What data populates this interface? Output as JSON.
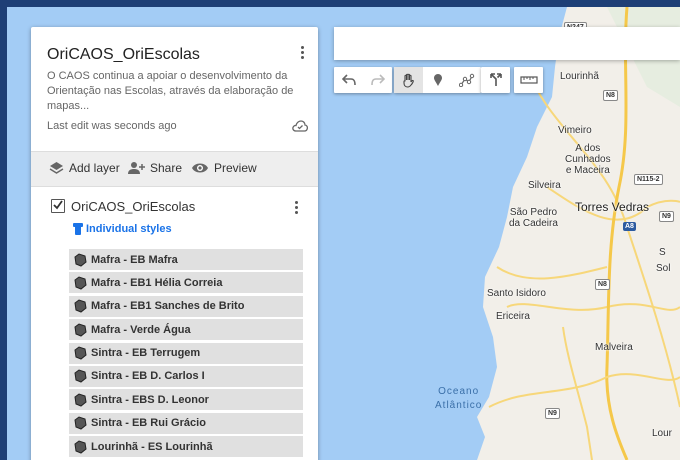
{
  "panel": {
    "title": "OriCAOS_OriEscolas",
    "description": "O CAOS continua a apoiar o desenvolvimento da Orientação nas Escolas, através da elaboração de mapas...",
    "last_edit": "Last edit was seconds ago",
    "actions": {
      "add_layer": "Add layer",
      "share": "Share",
      "preview": "Preview"
    },
    "layer": {
      "name": "OriCAOS_OriEscolas",
      "checked": true,
      "styles_label": "Individual styles",
      "features": [
        "Mafra - EB Mafra",
        "Mafra - EB1 Hélia Correia",
        "Mafra - EB1 Sanches de Brito",
        "Mafra - Verde Água",
        "Sintra - EB Terrugem",
        "Sintra - EB D. Carlos I",
        "Sintra - EBS D. Leonor",
        "Sintra - EB Rui Grácio",
        "Lourinhã - ES Lourinhã"
      ]
    }
  },
  "search": {
    "placeholder": ""
  },
  "toolbar": {
    "group1": [
      "undo-icon",
      "redo-icon"
    ],
    "group2": [
      "hand-icon",
      "marker-icon",
      "draw-line-icon"
    ],
    "group3": [
      "directions-icon"
    ],
    "group4": [
      "ruler-icon"
    ],
    "selected": "hand-icon"
  },
  "map": {
    "places": {
      "lourinha": "Lourinhã",
      "vimeiro": "Vimeiro",
      "a_dos_cunhados": "A dos\nCunhados\ne Maceira",
      "silveira": "Silveira",
      "sao_pedro": "São Pedro\nda Cadeira",
      "torres_vedras": "Torres Vedras",
      "santo_isidoro": "Santo Isidoro",
      "ericeira": "Ericeira",
      "malveira": "Malveira",
      "ocean": "Oceano\nAtlântico",
      "loures": "Lour",
      "sol": "Sol",
      "s": "S"
    },
    "roads": {
      "n247": "N247",
      "n8_1": "N8",
      "n115_2": "N115-2",
      "n9_1": "N9",
      "a8": "A8",
      "n8_2": "N8",
      "n9_2": "N9"
    },
    "colors": {
      "water": "#a3ccf5",
      "land": "#f2efe9",
      "accent": "#1a73e8"
    }
  }
}
